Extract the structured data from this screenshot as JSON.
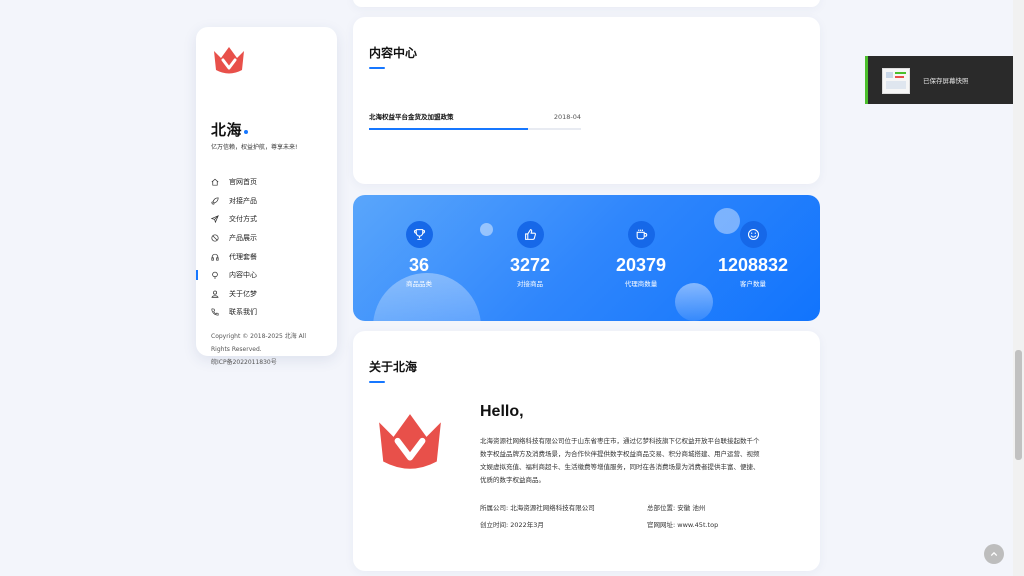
{
  "sidebar": {
    "brand": "北海",
    "slogan": "亿万信赖，权益护航，尊享未来!",
    "nav": [
      {
        "label": "官网首页",
        "icon": "home-icon",
        "active": false
      },
      {
        "label": "对接产品",
        "icon": "rocket-icon",
        "active": false
      },
      {
        "label": "交付方式",
        "icon": "send-icon",
        "active": false
      },
      {
        "label": "产品展示",
        "icon": "forbidden-icon",
        "active": false
      },
      {
        "label": "代理套餐",
        "icon": "headphones-icon",
        "active": false
      },
      {
        "label": "内容中心",
        "icon": "bulb-icon",
        "active": true
      },
      {
        "label": "关于亿梦",
        "icon": "user-icon",
        "active": false
      },
      {
        "label": "联系我们",
        "icon": "phone-icon",
        "active": false
      }
    ],
    "copyright_line1": "Copyright © 2018-2025 北海 All",
    "copyright_line2": "Rights Reserved.",
    "icp": "皖ICP备2022011830号"
  },
  "content_center": {
    "title": "内容中心",
    "news": [
      {
        "title": "北海权益平台金货及加盟政策",
        "date": "2018-04"
      }
    ]
  },
  "stats": [
    {
      "value": "36",
      "label": "商品品类",
      "icon": "trophy-icon"
    },
    {
      "value": "3272",
      "label": "对接商品",
      "icon": "thumbs-up-icon"
    },
    {
      "value": "20379",
      "label": "代理商数量",
      "icon": "coffee-cup-icon"
    },
    {
      "value": "1208832",
      "label": "客户数量",
      "icon": "smile-icon"
    }
  ],
  "about": {
    "title": "关于北海",
    "hello": "Hello,",
    "text_lines": [
      "北海资源社网络科技有限公司位于山东省枣庄市，通过亿梦科技旗下亿权益开放平台联接起数千个",
      "数字权益品牌方及消费场景，为合作伙伴提供数字权益商品交易、积分商城搭建、用户运营、视频",
      "文娱虚拟充值、福利商超卡、生活缴费等增值服务，同时在各消费场景为消费者提供丰富、便捷、",
      "优质的数字权益商品。"
    ],
    "company": "所属公司: 北海资源社网络科技有限公司",
    "location": "总部位置: 安徽 池州",
    "founded": "创立时间: 2022年3月",
    "website": "官网网址: www.45t.top"
  },
  "toast": {
    "message": "已保存屏幕快照"
  },
  "colors": {
    "accent": "#1677ff",
    "logo_red": "#e8504a",
    "toast_success": "#4bbf2c"
  }
}
